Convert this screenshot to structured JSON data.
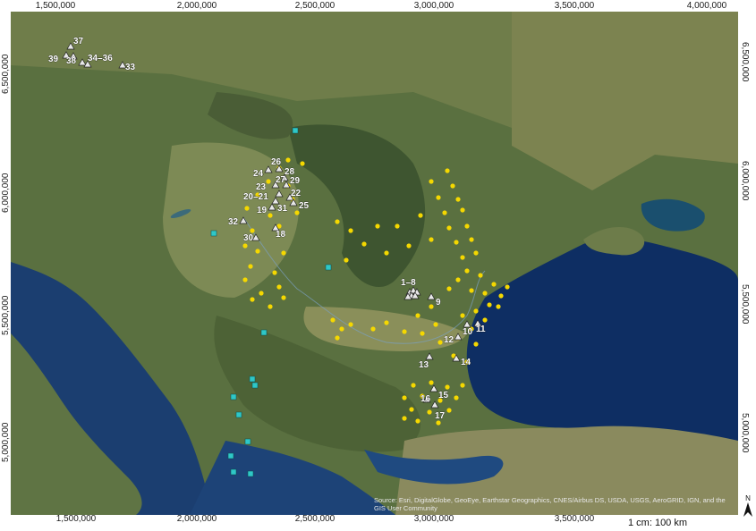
{
  "axes": {
    "top": [
      "1,500,000",
      "2,000,000",
      "2,500,000",
      "3,000,000",
      "3,500,000",
      "4,000,000"
    ],
    "bottom": [
      "1,500,000",
      "2,000,000",
      "2,500,000",
      "3,000,000",
      "3,500,000"
    ],
    "left": [
      "6,500,000",
      "6,000,000",
      "5,500,000",
      "5,000,000"
    ],
    "right": [
      "6,500,000",
      "6,000,000",
      "5,500,000",
      "5,000,000"
    ]
  },
  "attribution": "Source: Esri, DigitalGlobe, GeoEye, Earthstar Geographics, CNES/Airbus DS, USDA, USGS, AeroGRID, IGN, and the GIS User Community",
  "scale": "1 cm: 100 km",
  "north": "N",
  "colors": {
    "yellow_sites": "#f5d800",
    "cyan_sites": "#2fc7c7",
    "triangle_sites": "#e8e8e8"
  },
  "site_labels": [
    "37",
    "39",
    "38",
    "34–36",
    "33",
    "26",
    "28",
    "24",
    "27",
    "29",
    "23",
    "20–21",
    "22",
    "19",
    "31",
    "25",
    "32",
    "18",
    "30",
    "1–8",
    "9",
    "10",
    "11",
    "12",
    "13",
    "14",
    "15",
    "16",
    "17"
  ]
}
